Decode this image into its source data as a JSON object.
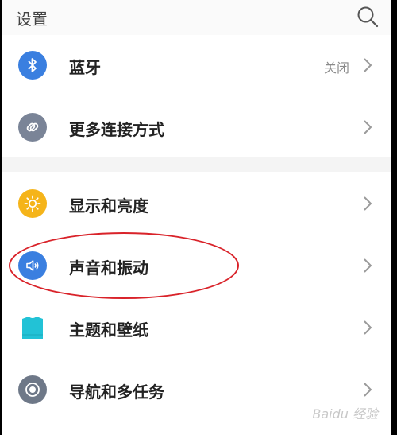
{
  "header": {
    "title": "设置"
  },
  "group1": [
    {
      "id": "bluetooth",
      "label": "蓝牙",
      "value": "关闭",
      "icon": "bluetooth-icon",
      "color": "#3a7fe0"
    },
    {
      "id": "more-connections",
      "label": "更多连接方式",
      "value": "",
      "icon": "link-icon",
      "color": "#7a8497"
    }
  ],
  "group2": [
    {
      "id": "display",
      "label": "显示和亮度",
      "value": "",
      "icon": "sun-icon",
      "color": "#f5b41a"
    },
    {
      "id": "sound",
      "label": "声音和振动",
      "value": "",
      "icon": "speaker-icon",
      "color": "#3a7fe0"
    },
    {
      "id": "theme",
      "label": "主题和壁纸",
      "value": "",
      "icon": "shirt-icon",
      "color": "#22c2d6"
    },
    {
      "id": "navigation",
      "label": "导航和多任务",
      "value": "",
      "icon": "target-icon",
      "color": "#6e7888"
    }
  ],
  "watermark": "Baidu 经验",
  "colors": {
    "highlight": "#d9232a",
    "background": "#f4f4f4"
  }
}
